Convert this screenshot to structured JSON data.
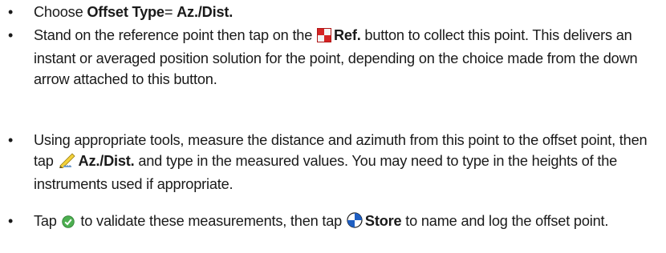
{
  "items": [
    {
      "pre": "Choose ",
      "bold1": "Offset Type",
      "mid": "= ",
      "bold2": "Az./Dist."
    },
    {
      "pre": "Stand on the reference point then tap on the ",
      "icon": "ref-point-icon",
      "bold": "Ref.",
      "post": " button to collect this point. This delivers an instant or averaged position solution for the point, depending on the choice made from the down arrow attached to this button."
    },
    {
      "pre": "Using appropriate tools, measure the distance and azimuth from this point to the offset point, then tap ",
      "icon": "ruler-pencil-icon",
      "bold": "Az./Dist.",
      "post": " and type in the measured values. You may need to type in the heights of the instruments used if appropriate."
    },
    {
      "pre": "Tap ",
      "icon1": "checkmark-icon",
      "mid": " to validate these measurements, then tap ",
      "icon2": "store-target-icon",
      "bold": "Store",
      "post": " to name and log the offset point."
    }
  ],
  "bullet_char": "•",
  "colors": {
    "text": "#1a1a1a",
    "ref_red": "#d42323",
    "check_green": "#4caf50",
    "store_blue": "#1f5fc2"
  }
}
